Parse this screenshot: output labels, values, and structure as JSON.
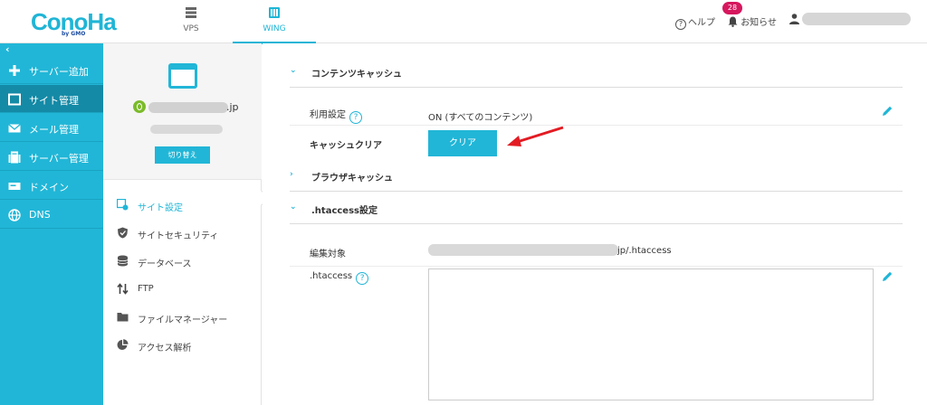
{
  "header": {
    "logo": "ConoHa",
    "logo_sub": "by GMO",
    "tabs": [
      {
        "label": "VPS"
      },
      {
        "label": "WING"
      }
    ],
    "help": "ヘルプ",
    "notifications": "お知らせ",
    "notification_count": "28"
  },
  "sidebar": {
    "collapse": "‹",
    "items": [
      {
        "label": "サーバー追加"
      },
      {
        "label": "サイト管理"
      },
      {
        "label": "メール管理"
      },
      {
        "label": "サーバー管理"
      },
      {
        "label": "ドメイン"
      },
      {
        "label": "DNS"
      }
    ]
  },
  "site": {
    "domain_suffix": ".jp",
    "switch_button": "切り替え",
    "menu": [
      {
        "label": "サイト設定"
      },
      {
        "label": "サイトセキュリティ"
      },
      {
        "label": "データベース"
      },
      {
        "label": "FTP"
      },
      {
        "label": "ファイルマネージャー"
      },
      {
        "label": "アクセス解析"
      }
    ]
  },
  "main": {
    "content_cache": {
      "title": "コンテンツキャッシュ",
      "usage_label": "利用設定",
      "usage_value": "ON (すべてのコンテンツ)",
      "clear_label": "キャッシュクリア",
      "clear_button": "クリア"
    },
    "browser_cache": {
      "title": "ブラウザキャッシュ"
    },
    "htaccess": {
      "title": ".htaccess設定",
      "target_label": "編集対象",
      "target_path_suffix": "jp/.htaccess",
      "file_label": ".htaccess",
      "content": ""
    }
  },
  "colors": {
    "accent": "#21b6d7",
    "sidebar_active": "#148aa6",
    "badge": "#d6175e",
    "arrow": "#e31b23",
    "power": "#7bbb2b"
  }
}
